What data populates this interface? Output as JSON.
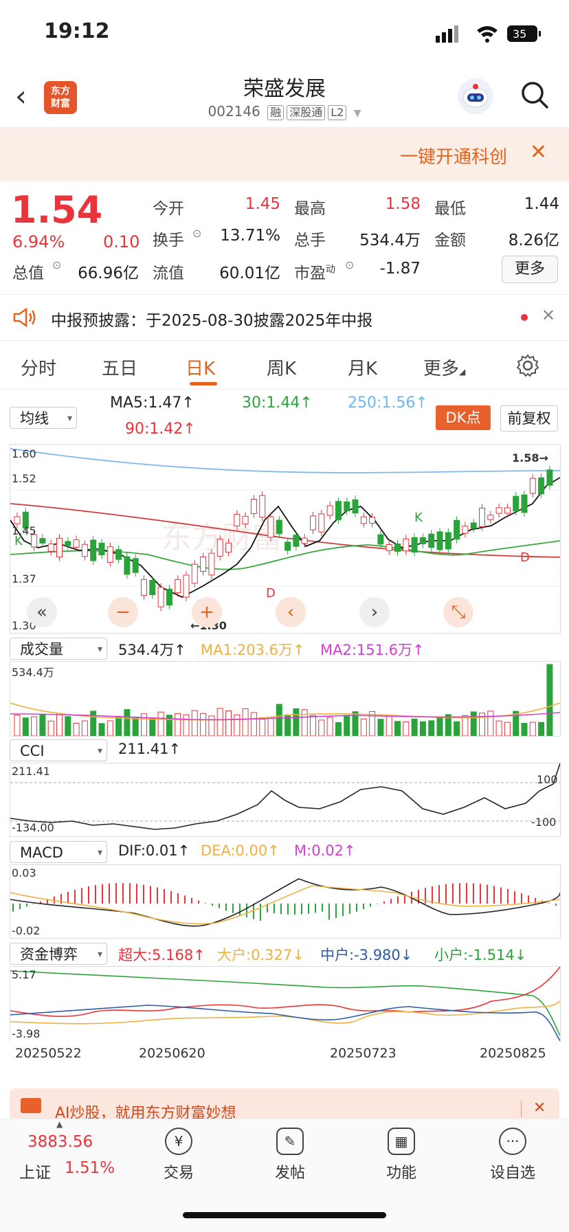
{
  "status": {
    "time": "19:12",
    "battery": "35"
  },
  "header": {
    "title": "荣盛发展",
    "code": "002146",
    "tags": [
      "融",
      "深股通",
      "L2"
    ],
    "logo_text": "东方财富",
    "back_icon": "chevron-left-icon",
    "search_icon": "search-icon"
  },
  "banner": {
    "text": "一键开通科创",
    "close": "✕"
  },
  "quote": {
    "price": "1.54",
    "change_pct": "6.94%",
    "change": "0.10",
    "open_label": "今开",
    "open": "1.45",
    "high_label": "最高",
    "high": "1.58",
    "low_label": "最低",
    "low": "1.44",
    "turnover_label": "换手",
    "turnover": "13.71%",
    "volume_label": "总手",
    "volume": "534.4万",
    "amount_label": "金额",
    "amount": "8.26亿",
    "mcap_label": "总值",
    "mcap": "66.96亿",
    "float_label": "流值",
    "float": "60.01亿",
    "pe_label": "市盈",
    "pe_sup": "动",
    "pe": "-1.87",
    "more": "更多"
  },
  "notice": {
    "text": "中报预披露：于2025-08-30披露2025年中报"
  },
  "tabs": [
    "分时",
    "五日",
    "日K",
    "周K",
    "月K",
    "更多"
  ],
  "active_tab": "日K",
  "ma": {
    "selector": "均线",
    "ma5": "MA5:1.47",
    "ma30": "30:1.44",
    "ma250": "250:1.56",
    "ma90": "90:1.42",
    "dk": "DK点",
    "fq": "前复权"
  },
  "kline": {
    "y_labels": [
      "1.60",
      "1.52",
      "1.45",
      "1.37",
      "1.30"
    ],
    "max_label": "1.58",
    "min_label": "1.30",
    "marker_k": "K",
    "marker_d": "D"
  },
  "volume": {
    "selector": "成交量",
    "value": "534.4万",
    "ma1": "MA1:203.6万",
    "ma2": "MA2:151.6万",
    "top_label": "534.4万"
  },
  "cci": {
    "selector": "CCI",
    "value": "211.41",
    "top_label": "211.41",
    "bottom_label": "-134.00",
    "line_100": "100",
    "line_neg100": "-100"
  },
  "macd": {
    "selector": "MACD",
    "dif": "DIF:0.01",
    "dea": "DEA:0.00",
    "m": "M:0.02",
    "top_label": "0.03",
    "bottom_label": "-0.02"
  },
  "capital": {
    "selector": "资金博弈",
    "super": "超大:5.168",
    "large": "大户:0.327",
    "mid": "中户:-3.980",
    "small": "小户:-1.514",
    "top_label": "5.17",
    "bottom_label": "-3.98"
  },
  "dates": [
    "20250522",
    "20250620",
    "20250723",
    "20250825"
  ],
  "ai_banner": {
    "text": "AI炒股，就用东方财富妙想"
  },
  "bottom_nav": {
    "index_value": "3883.56",
    "index_name": "上证",
    "index_pct": "1.51%",
    "items": [
      "交易",
      "发帖",
      "功能",
      "设自选"
    ]
  },
  "colors": {
    "up": "#e8343a",
    "down": "#2aa33a",
    "accent": "#e06420"
  }
}
